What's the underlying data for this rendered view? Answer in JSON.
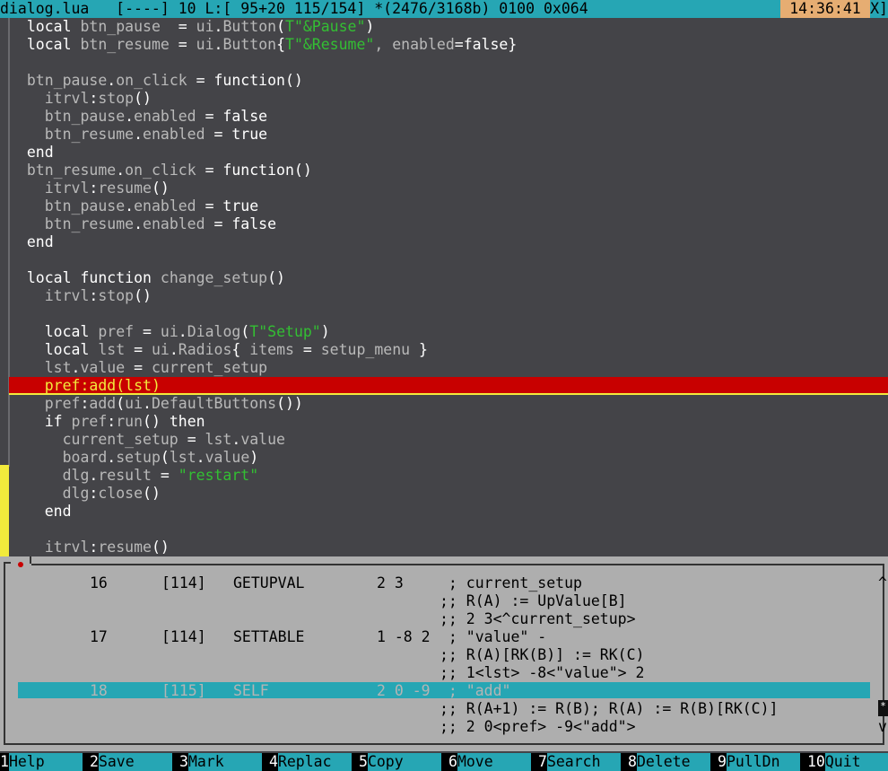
{
  "status_bar": {
    "filename": "dialog.lua",
    "info": "[----] 10 L:[ 95+20 115/154] *(2476/3168b) 0100 0x064",
    "clock": "14:36:41",
    "close": "X]"
  },
  "editor": {
    "lines": [
      [
        [
          "  ",
          "op"
        ],
        [
          "local",
          "kw"
        ],
        [
          " btn_pause  ",
          "id"
        ],
        [
          "=",
          "op"
        ],
        [
          " ui",
          "id"
        ],
        [
          ".",
          "op"
        ],
        [
          "Button",
          "id"
        ],
        [
          "(",
          "op"
        ],
        [
          "T",
          "str"
        ],
        [
          "\"&Pause\"",
          "str"
        ],
        [
          ")",
          "op"
        ]
      ],
      [
        [
          "  ",
          "op"
        ],
        [
          "local",
          "kw"
        ],
        [
          " btn_resume ",
          "id"
        ],
        [
          "=",
          "op"
        ],
        [
          " ui",
          "id"
        ],
        [
          ".",
          "op"
        ],
        [
          "Button",
          "id"
        ],
        [
          "{",
          "op"
        ],
        [
          "T",
          "str"
        ],
        [
          "\"&Resume\"",
          "str"
        ],
        [
          ", enabled",
          "id"
        ],
        [
          "=",
          "op"
        ],
        [
          "false",
          "kw"
        ],
        [
          "}",
          "op"
        ]
      ],
      [],
      [
        [
          "  ",
          "op"
        ],
        [
          "btn_pause",
          "id"
        ],
        [
          ".",
          "op"
        ],
        [
          "on_click ",
          "id"
        ],
        [
          "=",
          "op"
        ],
        [
          " function",
          "kw"
        ],
        [
          "()",
          "op"
        ]
      ],
      [
        [
          "    itrvl",
          "id"
        ],
        [
          ":",
          "op"
        ],
        [
          "stop",
          "id"
        ],
        [
          "()",
          "op"
        ]
      ],
      [
        [
          "    btn_pause",
          "id"
        ],
        [
          ".",
          "op"
        ],
        [
          "enabled ",
          "id"
        ],
        [
          "=",
          "op"
        ],
        [
          " false",
          "kw"
        ]
      ],
      [
        [
          "    btn_resume",
          "id"
        ],
        [
          ".",
          "op"
        ],
        [
          "enabled ",
          "id"
        ],
        [
          "=",
          "op"
        ],
        [
          " true",
          "kw"
        ]
      ],
      [
        [
          "  ",
          "op"
        ],
        [
          "end",
          "kw"
        ]
      ],
      [
        [
          "  ",
          "op"
        ],
        [
          "btn_resume",
          "id"
        ],
        [
          ".",
          "op"
        ],
        [
          "on_click ",
          "id"
        ],
        [
          "=",
          "op"
        ],
        [
          " function",
          "kw"
        ],
        [
          "()",
          "op"
        ]
      ],
      [
        [
          "    itrvl",
          "id"
        ],
        [
          ":",
          "op"
        ],
        [
          "resume",
          "id"
        ],
        [
          "()",
          "op"
        ]
      ],
      [
        [
          "    btn_pause",
          "id"
        ],
        [
          ".",
          "op"
        ],
        [
          "enabled ",
          "id"
        ],
        [
          "=",
          "op"
        ],
        [
          " true",
          "kw"
        ]
      ],
      [
        [
          "    btn_resume",
          "id"
        ],
        [
          ".",
          "op"
        ],
        [
          "enabled ",
          "id"
        ],
        [
          "=",
          "op"
        ],
        [
          " false",
          "kw"
        ]
      ],
      [
        [
          "  ",
          "op"
        ],
        [
          "end",
          "kw"
        ]
      ],
      [],
      [
        [
          "  ",
          "op"
        ],
        [
          "local function",
          "kw"
        ],
        [
          " change_setup",
          "id"
        ],
        [
          "()",
          "op"
        ]
      ],
      [
        [
          "    itrvl",
          "id"
        ],
        [
          ":",
          "op"
        ],
        [
          "stop",
          "id"
        ],
        [
          "()",
          "op"
        ]
      ],
      [],
      [
        [
          "    ",
          "op"
        ],
        [
          "local",
          "kw"
        ],
        [
          " pref ",
          "id"
        ],
        [
          "=",
          "op"
        ],
        [
          " ui",
          "id"
        ],
        [
          ".",
          "op"
        ],
        [
          "Dialog",
          "id"
        ],
        [
          "(",
          "op"
        ],
        [
          "T",
          "str"
        ],
        [
          "\"Setup\"",
          "str"
        ],
        [
          ")",
          "op"
        ]
      ],
      [
        [
          "    ",
          "op"
        ],
        [
          "local",
          "kw"
        ],
        [
          " lst ",
          "id"
        ],
        [
          "=",
          "op"
        ],
        [
          " ui",
          "id"
        ],
        [
          ".",
          "op"
        ],
        [
          "Radios",
          "id"
        ],
        [
          "{",
          "op"
        ],
        [
          " items ",
          "id"
        ],
        [
          "=",
          "op"
        ],
        [
          " setup_menu ",
          "id"
        ],
        [
          "}",
          "op"
        ]
      ],
      [
        [
          "    lst",
          "id"
        ],
        [
          ".",
          "op"
        ],
        [
          "value ",
          "id"
        ],
        [
          "=",
          "op"
        ],
        [
          " current_setup",
          "id"
        ]
      ],
      [
        [
          "    pref:add(lst)",
          "hl"
        ]
      ],
      [
        [
          "    pref",
          "id"
        ],
        [
          ":",
          "op"
        ],
        [
          "add",
          "id"
        ],
        [
          "(",
          "op"
        ],
        [
          "ui",
          "id"
        ],
        [
          ".",
          "op"
        ],
        [
          "DefaultButtons",
          "id"
        ],
        [
          "())",
          "op"
        ]
      ],
      [
        [
          "    ",
          "op"
        ],
        [
          "if",
          "kw"
        ],
        [
          " pref",
          "id"
        ],
        [
          ":",
          "op"
        ],
        [
          "run",
          "id"
        ],
        [
          "() ",
          "op"
        ],
        [
          "then",
          "kw"
        ]
      ],
      [
        [
          "      current_setup ",
          "id"
        ],
        [
          "=",
          "op"
        ],
        [
          " lst",
          "id"
        ],
        [
          ".",
          "op"
        ],
        [
          "value",
          "id"
        ]
      ],
      [
        [
          "      board",
          "id"
        ],
        [
          ".",
          "op"
        ],
        [
          "setup",
          "id"
        ],
        [
          "(",
          "op"
        ],
        [
          "lst",
          "id"
        ],
        [
          ".",
          "op"
        ],
        [
          "value",
          "id"
        ],
        [
          ")",
          "op"
        ]
      ],
      [
        [
          "      dlg",
          "id"
        ],
        [
          ".",
          "op"
        ],
        [
          "result ",
          "id"
        ],
        [
          "=",
          "op"
        ],
        [
          " \"restart\"",
          "str"
        ]
      ],
      [
        [
          "      dlg",
          "id"
        ],
        [
          ":",
          "op"
        ],
        [
          "close",
          "id"
        ],
        [
          "()",
          "op"
        ]
      ],
      [
        [
          "    ",
          "op"
        ],
        [
          "end",
          "kw"
        ]
      ],
      [],
      [
        [
          "    itrvl",
          "id"
        ],
        [
          ":",
          "op"
        ],
        [
          "resume",
          "id"
        ],
        [
          "()",
          "op"
        ]
      ]
    ]
  },
  "debug_panel": {
    "rows": [
      {
        "num": "16",
        "addr": "[114]",
        "op": "GETUPVAL",
        "args": "2 3",
        "comment": " ; current_setup"
      },
      {
        "num": "",
        "addr": "",
        "op": "",
        "args": "",
        "comment": ";; R(A) := UpValue[B]"
      },
      {
        "num": "",
        "addr": "",
        "op": "",
        "args": "",
        "comment": ";; 2 3<^current_setup>"
      },
      {
        "num": "17",
        "addr": "[114]",
        "op": "SETTABLE",
        "args": "1 -8 2",
        "comment": " ; \"value\" -"
      },
      {
        "num": "",
        "addr": "",
        "op": "",
        "args": "",
        "comment": ";; R(A)[RK(B)] := RK(C)"
      },
      {
        "num": "",
        "addr": "",
        "op": "",
        "args": "",
        "comment": ";; 1<lst> -8<\"value\"> 2"
      },
      {
        "num": "18",
        "addr": "[115]",
        "op": "SELF",
        "args": "2 0 -9",
        "comment": " ; \"add\""
      },
      {
        "num": "",
        "addr": "",
        "op": "",
        "args": "",
        "comment": ";; R(A+1) := R(B); R(A) := R(B)[RK(C)]"
      },
      {
        "num": "",
        "addr": "",
        "op": "",
        "args": "",
        "comment": ";; 2 0<pref> -9<\"add\">"
      }
    ],
    "scroll_up": "^",
    "scroll_thumb": "*",
    "scroll_down": "v"
  },
  "fkeys": [
    {
      "n": "1",
      "label": "Help"
    },
    {
      "n": "2",
      "label": "Save"
    },
    {
      "n": "3",
      "label": "Mark"
    },
    {
      "n": "4",
      "label": "Replac"
    },
    {
      "n": "5",
      "label": "Copy"
    },
    {
      "n": "6",
      "label": "Move"
    },
    {
      "n": "7",
      "label": "Search"
    },
    {
      "n": "8",
      "label": "Delete"
    },
    {
      "n": "9",
      "label": "PullDn"
    },
    {
      "n": "10",
      "label": "Quit"
    }
  ],
  "colors": {
    "status_bg": "#26a6b4",
    "clock_bg": "#e6ad72",
    "editor_bg": "#444448",
    "highlight_line": "#c80000",
    "string": "#33bf33",
    "panel_bg": "#aeaeae"
  }
}
